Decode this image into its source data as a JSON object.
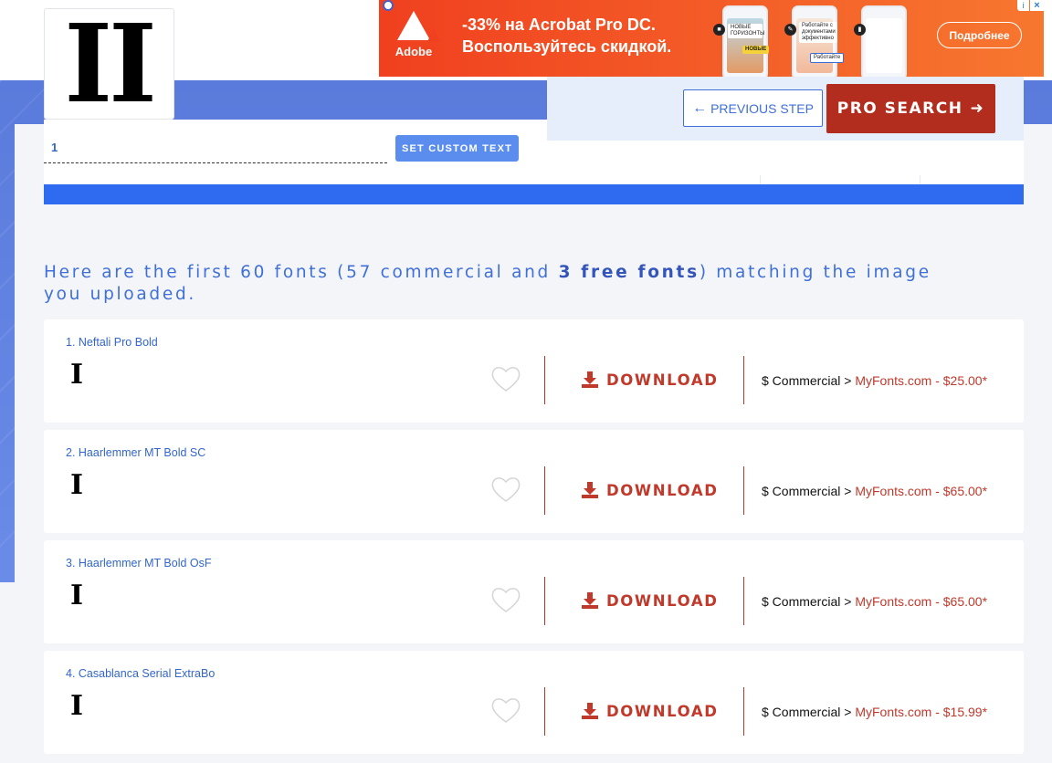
{
  "preview": {
    "glyph": "II"
  },
  "custom_text": {
    "value": "1",
    "button_label": "SET CUSTOM TEXT"
  },
  "nav": {
    "prev_label": "PREVIOUS STEP",
    "pro_label": "PRO SEARCH"
  },
  "ad": {
    "brand": "Adobe",
    "line1": "-33% на Acrobat Pro DC.",
    "line2": "Воспользуйтесь скидкой.",
    "tag1": "НОВЫЕ ГОРИЗОНТЫ",
    "tag2": "НОВЫЕ",
    "tag3": "Работайте с документами эффективно",
    "tag4": "Работайте",
    "cta": "Подробнее",
    "colors": {
      "start": "#f0401f",
      "end": "#f7772f"
    }
  },
  "headline": {
    "prefix": "Here are the first 60 fonts (57 commercial and ",
    "bold": "3 free fonts",
    "suffix": ") matching the image you uploaded."
  },
  "results": [
    {
      "name": "1. Neftali Pro Bold",
      "sample": "I",
      "download": "DOWNLOAD",
      "price_prefix": "$ Commercial > ",
      "price_link": "MyFonts.com - $25.00*"
    },
    {
      "name": "2. Haarlemmer MT Bold SC",
      "sample": "I",
      "download": "DOWNLOAD",
      "price_prefix": "$ Commercial > ",
      "price_link": "MyFonts.com - $65.00*"
    },
    {
      "name": "3. Haarlemmer MT Bold OsF",
      "sample": "I",
      "download": "DOWNLOAD",
      "price_prefix": "$ Commercial > ",
      "price_link": "MyFonts.com - $65.00*"
    },
    {
      "name": "4. Casablanca Serial ExtraBo",
      "sample": "I",
      "download": "DOWNLOAD",
      "price_prefix": "$ Commercial > ",
      "price_link": "MyFonts.com - $15.99*"
    }
  ],
  "colors": {
    "accent": "#3f6fd8",
    "download": "#c0392b",
    "pro": "#b32d1e",
    "bar": "#2f6bf0"
  }
}
